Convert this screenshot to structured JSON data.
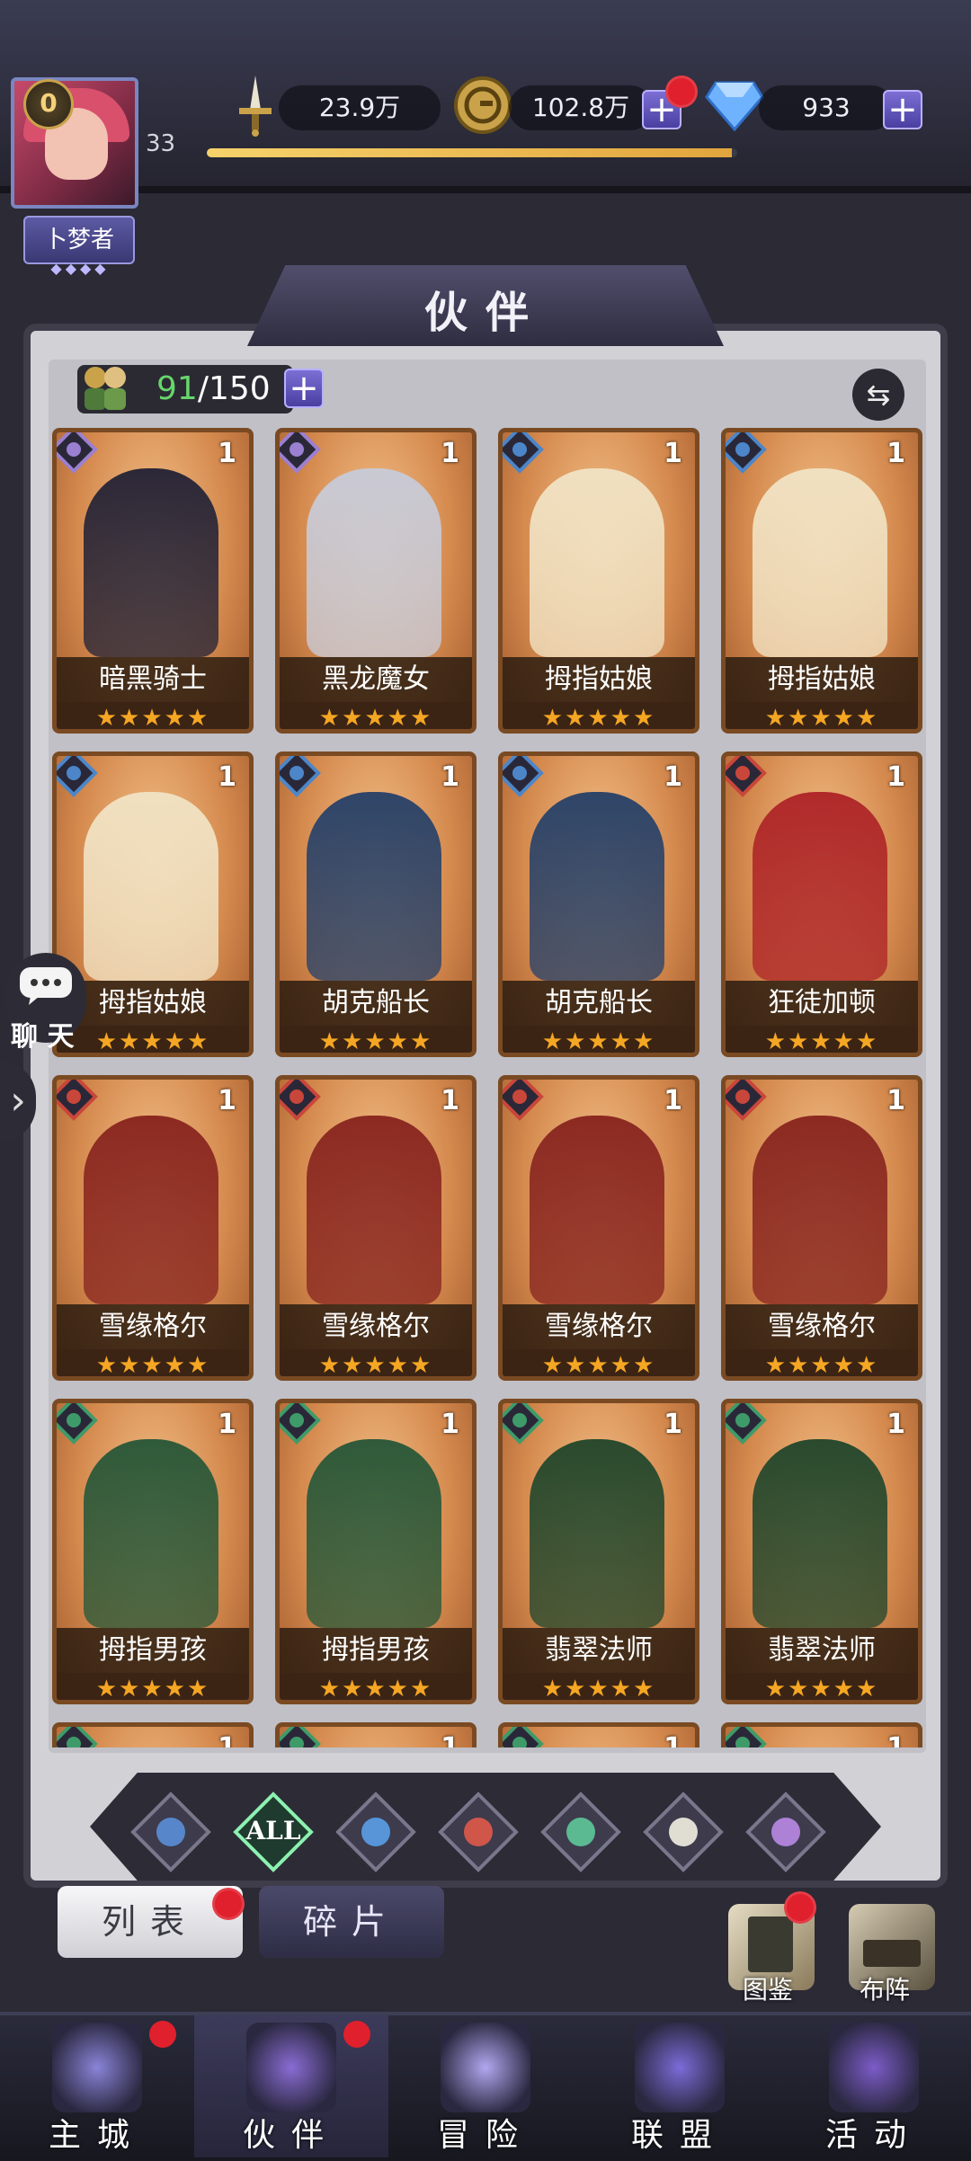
{
  "player": {
    "vip": "0",
    "level": "33",
    "title": "卜梦者",
    "xp_fraction": 0.99
  },
  "resources": {
    "power": "23.9万",
    "gold": "102.8万",
    "diamonds": "933"
  },
  "header": {
    "title": "伙伴"
  },
  "roster": {
    "current": "91",
    "max": "/150"
  },
  "cards": [
    {
      "name": "暗黑骑士",
      "level": "1",
      "stars": "★★★★★",
      "element": "dark",
      "color": "#2c2838"
    },
    {
      "name": "黑龙魔女",
      "level": "1",
      "stars": "★★★★★",
      "element": "dark",
      "color": "#c9c9d3"
    },
    {
      "name": "拇指姑娘",
      "level": "1",
      "stars": "★★★★★",
      "element": "water",
      "color": "#f0e0c0"
    },
    {
      "name": "拇指姑娘",
      "level": "1",
      "stars": "★★★★★",
      "element": "water",
      "color": "#f0e0c0"
    },
    {
      "name": "拇指姑娘",
      "level": "1",
      "stars": "★★★★★",
      "element": "water",
      "color": "#f0e0c0"
    },
    {
      "name": "胡克船长",
      "level": "1",
      "stars": "★★★★★",
      "element": "water",
      "color": "#2f4568"
    },
    {
      "name": "胡克船长",
      "level": "1",
      "stars": "★★★★★",
      "element": "water",
      "color": "#2f4568"
    },
    {
      "name": "狂徒加顿",
      "level": "1",
      "stars": "★★★★★",
      "element": "fire",
      "color": "#b02a2a"
    },
    {
      "name": "雪缘格尔",
      "level": "1",
      "stars": "★★★★★",
      "element": "fire",
      "color": "#8c2a22"
    },
    {
      "name": "雪缘格尔",
      "level": "1",
      "stars": "★★★★★",
      "element": "fire",
      "color": "#8c2a22"
    },
    {
      "name": "雪缘格尔",
      "level": "1",
      "stars": "★★★★★",
      "element": "fire",
      "color": "#8c2a22"
    },
    {
      "name": "雪缘格尔",
      "level": "1",
      "stars": "★★★★★",
      "element": "fire",
      "color": "#8c2a22"
    },
    {
      "name": "拇指男孩",
      "level": "1",
      "stars": "★★★★★",
      "element": "wind",
      "color": "#2f5a3a"
    },
    {
      "name": "拇指男孩",
      "level": "1",
      "stars": "★★★★★",
      "element": "wind",
      "color": "#2f5a3a"
    },
    {
      "name": "翡翠法师",
      "level": "1",
      "stars": "★★★★★",
      "element": "wind",
      "color": "#2a4a2e"
    },
    {
      "name": "翡翠法师",
      "level": "1",
      "stars": "★★★★★",
      "element": "wind",
      "color": "#2a4a2e"
    },
    {
      "name": "",
      "level": "1",
      "stars": "",
      "element": "wind",
      "color": "#2a4a2e"
    },
    {
      "name": "",
      "level": "1",
      "stars": "",
      "element": "wind",
      "color": "#2a4a2e"
    },
    {
      "name": "",
      "level": "1",
      "stars": "",
      "element": "wind",
      "color": "#2a4a2e"
    },
    {
      "name": "",
      "level": "1",
      "stars": "",
      "element": "wind",
      "color": "#2a4a2e"
    }
  ],
  "filters": [
    {
      "key": "tent",
      "label": "",
      "icon": "tent-filter-icon",
      "color": "#5b8fd8"
    },
    {
      "key": "all",
      "label": "ALL",
      "icon": "all-filter-icon",
      "color": "#ffffff"
    },
    {
      "key": "water",
      "label": "",
      "icon": "water-element-icon",
      "color": "#5aa0e8"
    },
    {
      "key": "fire",
      "label": "",
      "icon": "fire-element-icon",
      "color": "#e05a4a"
    },
    {
      "key": "wind",
      "label": "",
      "icon": "wind-element-icon",
      "color": "#5ec99a"
    },
    {
      "key": "light",
      "label": "",
      "icon": "light-element-icon",
      "color": "#f2efe2"
    },
    {
      "key": "dark",
      "label": "",
      "icon": "dark-element-icon",
      "color": "#b98ae6"
    }
  ],
  "tabs": {
    "list": "列表",
    "fragments": "碎片"
  },
  "side_buttons": {
    "collection": "图鉴",
    "formation": "布阵"
  },
  "chat": {
    "label": "聊 天"
  },
  "nav": [
    {
      "label": "主城",
      "icon": "castle-icon",
      "badge": true,
      "active": false
    },
    {
      "label": "伙伴",
      "icon": "witch-hat-icon",
      "badge": true,
      "active": true
    },
    {
      "label": "冒险",
      "icon": "portal-icon",
      "badge": false,
      "active": false
    },
    {
      "label": "联盟",
      "icon": "shield-icon",
      "badge": false,
      "active": false
    },
    {
      "label": "活动",
      "icon": "cards-icon",
      "badge": false,
      "active": false
    }
  ],
  "colors": {
    "accent": "#7b6fd4",
    "badge": "#e0202c",
    "star": "#f5a623",
    "count_green": "#67d66b"
  }
}
